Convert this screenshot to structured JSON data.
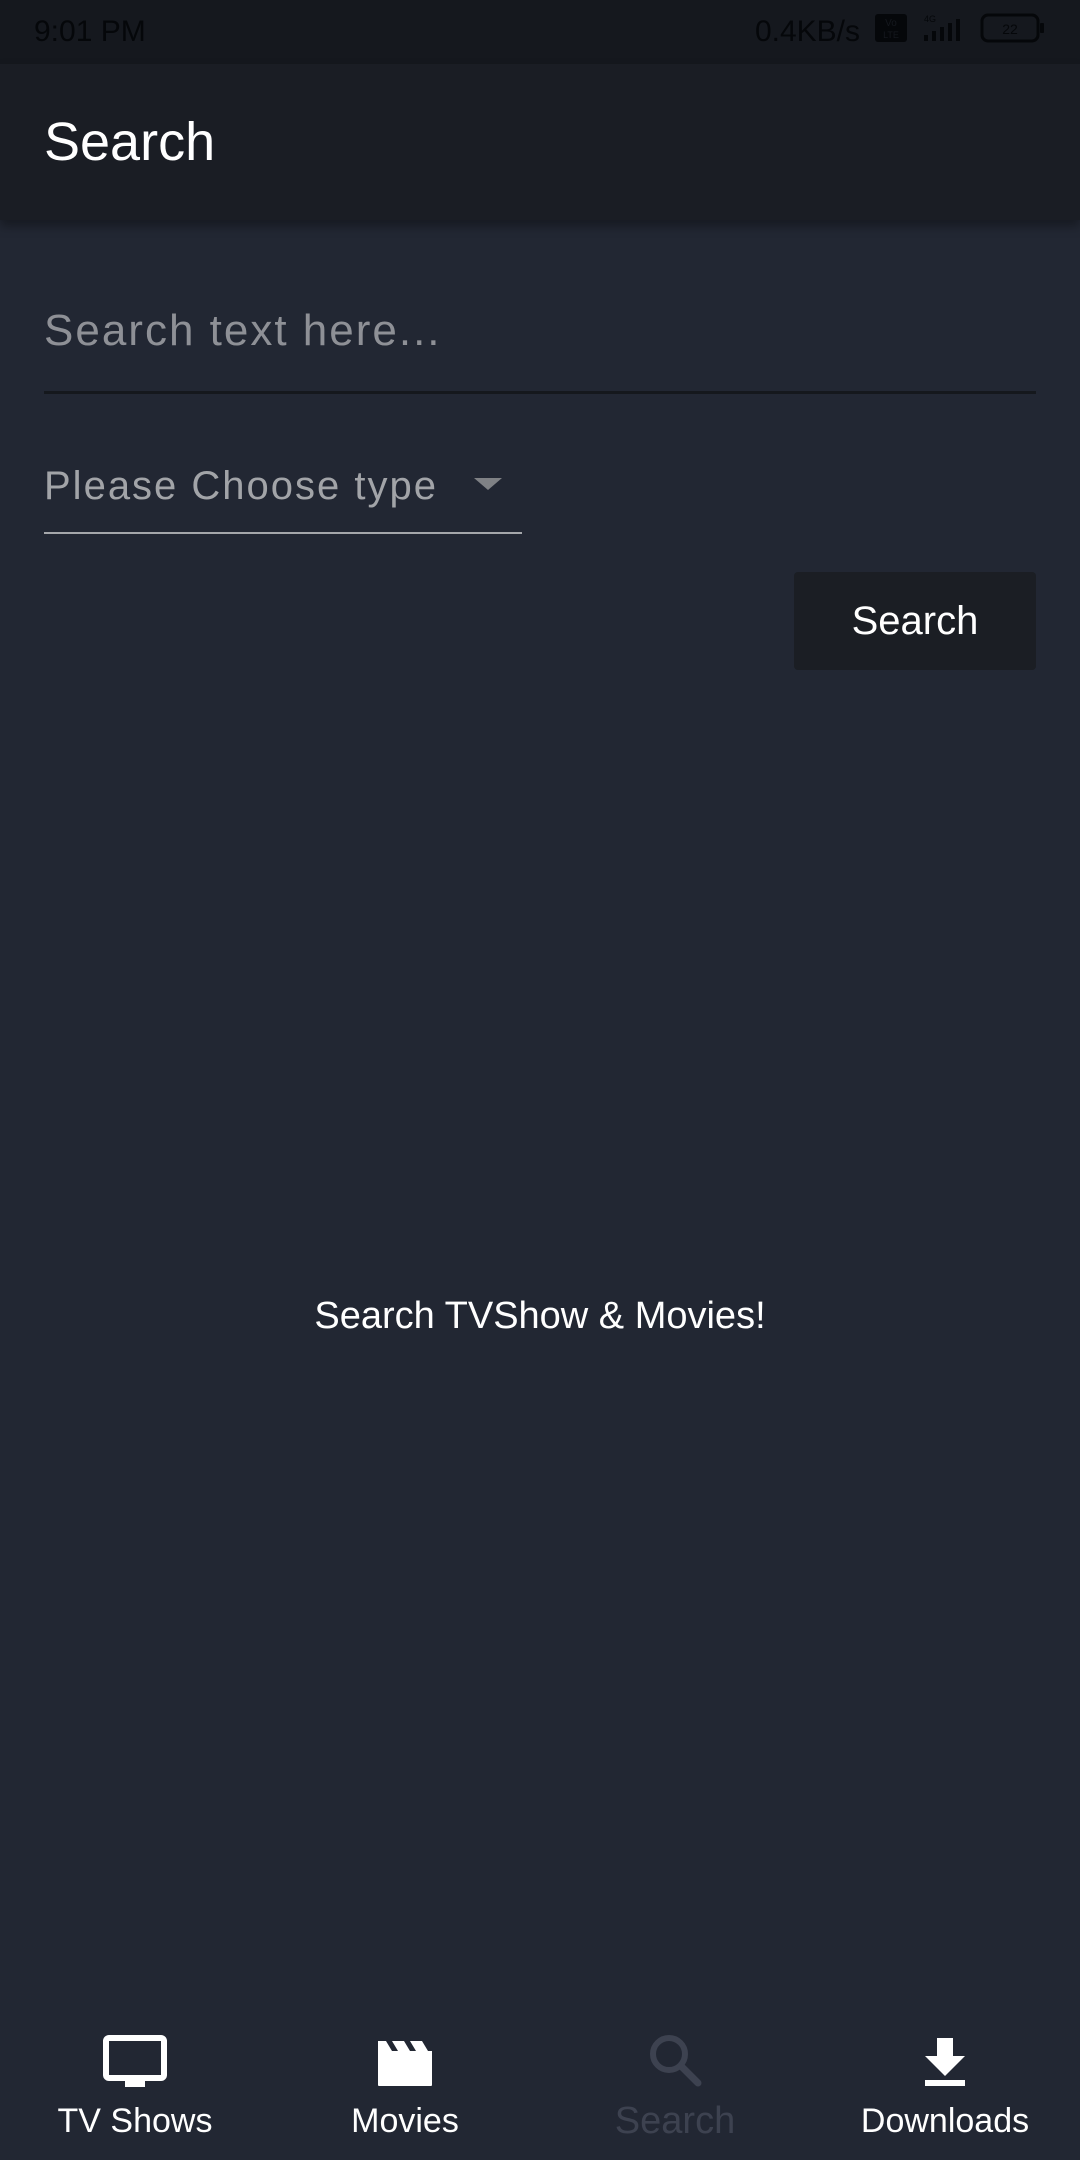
{
  "status_bar": {
    "time": "9:01 PM",
    "network_speed": "0.4KB/s",
    "volte_label": "VoLTE",
    "signal_label": "4G",
    "battery_level": "22"
  },
  "app_bar": {
    "title": "Search"
  },
  "search": {
    "placeholder": "Search text here...",
    "value": "",
    "type_placeholder": "Please Choose type",
    "button_label": "Search"
  },
  "empty_state": {
    "message": "Search TVShow & Movies!"
  },
  "bottom_nav": {
    "items": [
      {
        "label": "TV Shows",
        "icon": "tv-icon"
      },
      {
        "label": "Movies",
        "icon": "clapperboard-icon"
      },
      {
        "label": "Search",
        "icon": "search-icon",
        "active": true
      },
      {
        "label": "Downloads",
        "icon": "download-icon"
      }
    ]
  },
  "colors": {
    "background": "#222733",
    "app_bar": "#1a1d24",
    "button": "#1b1e24",
    "inactive_tab": "#3d4250",
    "text": "#ffffff"
  }
}
